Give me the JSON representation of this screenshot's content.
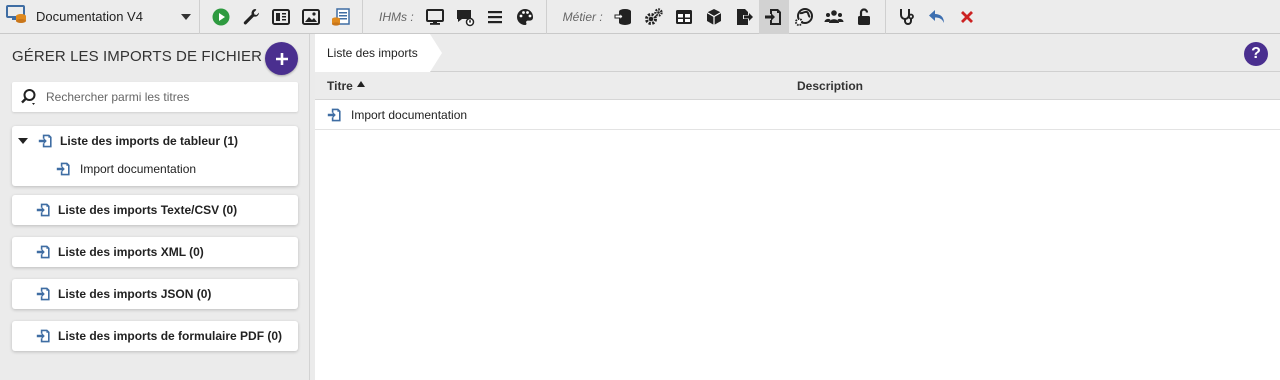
{
  "toolbar": {
    "project_name": "Documentation V4",
    "ihm_label": "IHMs :",
    "metier_label": "Métier :"
  },
  "left": {
    "title": "GÉRER LES IMPORTS DE FICHIER",
    "search_placeholder": "Rechercher parmi les titres",
    "groups": [
      {
        "label": "Liste des imports de tableur (1)",
        "expanded": true,
        "items": [
          "Import documentation"
        ]
      },
      {
        "label": "Liste des imports Texte/CSV (0)"
      },
      {
        "label": "Liste des imports XML (0)"
      },
      {
        "label": "Liste des imports JSON (0)"
      },
      {
        "label": "Liste des imports de formulaire PDF (0)"
      }
    ]
  },
  "main": {
    "breadcrumb": "Liste des imports",
    "help_label": "?",
    "columns": {
      "title": "Titre",
      "description": "Description"
    },
    "rows": [
      {
        "title": "Import documentation",
        "description": ""
      }
    ]
  },
  "colors": {
    "accent": "#4a2f8f",
    "import_icon": "#3f6da3",
    "run": "#2e9a40",
    "cancel": "#cc2222",
    "undo": "#3d6fb0"
  }
}
